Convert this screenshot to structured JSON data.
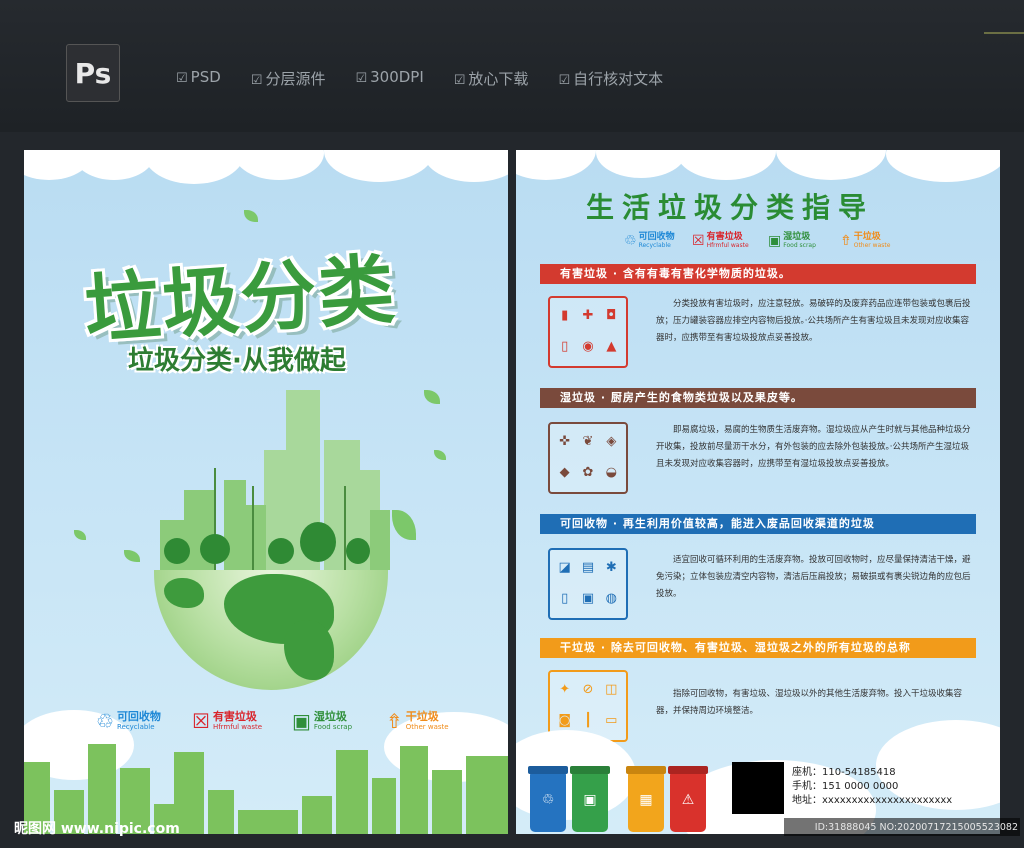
{
  "toolbar": {
    "logo": "Ps",
    "features": [
      "PSD",
      "分层源件",
      "300DPI",
      "放心下载",
      "自行核对文本"
    ]
  },
  "left_panel": {
    "title": "垃圾分类",
    "subtitle": "垃圾分类·从我做起",
    "legend": [
      {
        "label": "可回收物",
        "en": "Recyclable",
        "color": "#1e88d6",
        "icon": "recycle-icon"
      },
      {
        "label": "有害垃圾",
        "en": "Hfrmful waste",
        "color": "#d9252c",
        "icon": "hazard-icon"
      },
      {
        "label": "湿垃圾",
        "en": "Food scrap",
        "color": "#2f8f3a",
        "icon": "food-icon"
      },
      {
        "label": "干垃圾",
        "en": "Other waste",
        "color": "#f08c1a",
        "icon": "other-icon"
      }
    ]
  },
  "right_panel": {
    "title": "生活垃圾分类指导",
    "legend": [
      {
        "label": "可回收物",
        "en": "Recyclable",
        "color": "#1e88d6"
      },
      {
        "label": "有害垃圾",
        "en": "Hfrmful waste",
        "color": "#d9252c"
      },
      {
        "label": "湿垃圾",
        "en": "Food scrap",
        "color": "#2f8f3a"
      },
      {
        "label": "干垃圾",
        "en": "Other waste",
        "color": "#f08c1a"
      }
    ],
    "sections": [
      {
        "heading": "有害垃圾 · 含有有毒有害化学物质的垃圾。",
        "color": "#d33a2f",
        "text": "分类投放有害垃圾时，应注意轻放。易破碎的及废弃药品应连带包装或包裹后投放；压力罐装容器应排空内容物后投放。·公共场所产生有害垃圾且未发现对应收集容器时，应携带至有害垃圾投放点妥善投放。"
      },
      {
        "heading": "湿垃圾 · 厨房产生的食物类垃圾以及果皮等。",
        "color": "#7a4a3c",
        "text": "即易腐垃圾，易腐的生物质生活废弃物。湿垃圾应从产生时就与其他品种垃圾分开收集，投放前尽量沥干水分，有外包装的应去除外包装投放。·公共场所产生湿垃圾且未发现对应收集容器时，应携带至有湿垃圾投放点妥善投放。"
      },
      {
        "heading": "可回收物 · 再生利用价值较高，能进入废品回收渠道的垃圾",
        "color": "#1f6eb5",
        "text": "适宜回收可循环利用的生活废弃物。投放可回收物时，应尽量保持清洁干燥，避免污染；立体包装应清空内容物，清洁后压扁投放；易破损或有裹尖锐边角的应包后投放。"
      },
      {
        "heading": "干垃圾 · 除去可回收物、有害垃圾、湿垃圾之外的所有垃圾的总称",
        "color": "#f29b1a",
        "text": "指除可回收物，有害垃圾、湿垃圾以外的其他生活废弃物。投入干垃圾收集容器，并保持周边环境整洁。"
      }
    ],
    "bins": [
      {
        "color": "#2573c0",
        "icon": "♲"
      },
      {
        "color": "#35a04a",
        "icon": "▣"
      },
      {
        "color": "#f2a51c",
        "icon": "▦"
      },
      {
        "color": "#d9322c",
        "icon": "⚠"
      }
    ],
    "contact": {
      "phone": "座机：110-54185418",
      "mobile": "手机：151 0000 0000",
      "address": "地址：xxxxxxxxxxxxxxxxxxxxxx"
    }
  },
  "watermark": {
    "left": "昵图网 www.nipic.com",
    "right": "ID:31888045 NO:20200717215005523082"
  }
}
